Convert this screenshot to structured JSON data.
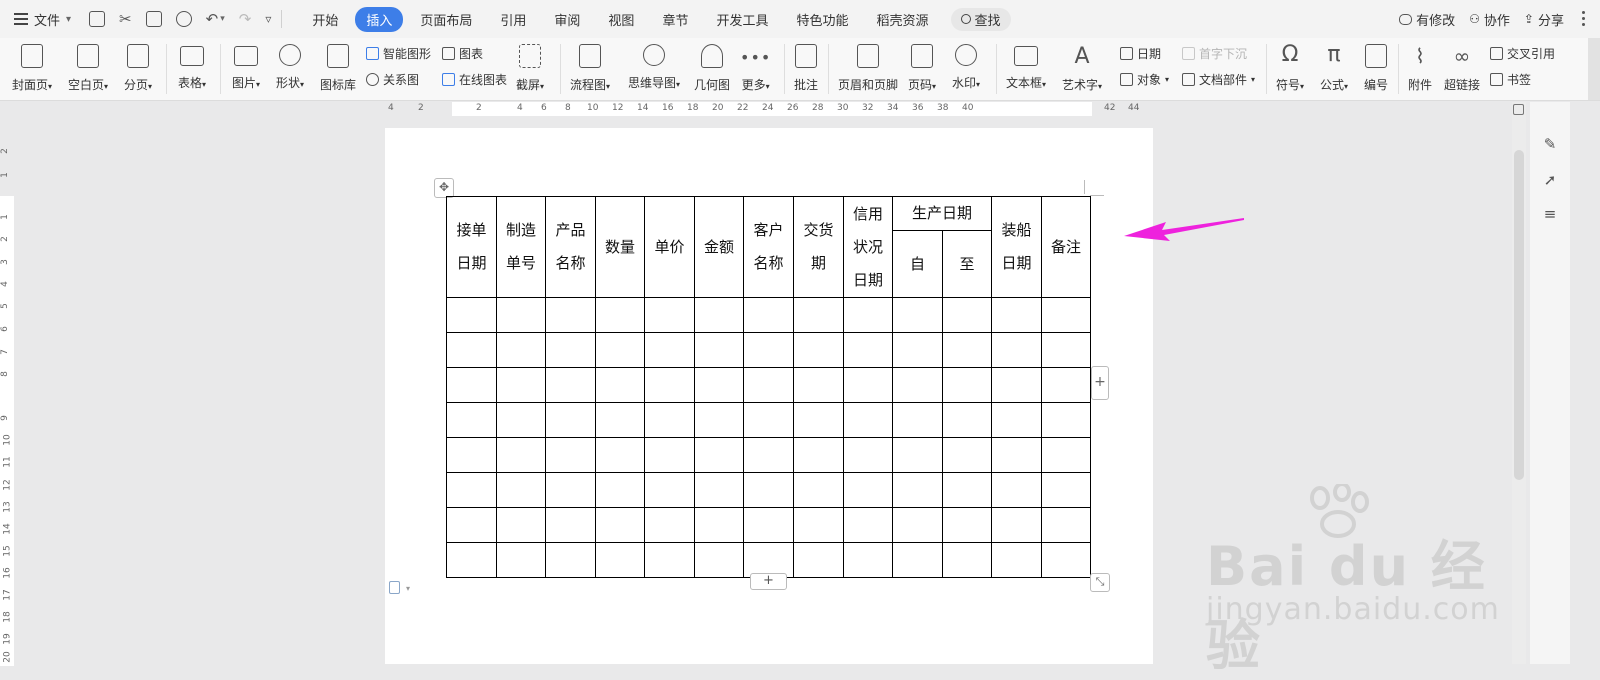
{
  "menu": {
    "file_label": "文件",
    "undo_caret": "▾",
    "tabs": [
      {
        "label": "开始",
        "active": false
      },
      {
        "label": "插入",
        "active": true
      },
      {
        "label": "页面布局",
        "active": false
      },
      {
        "label": "引用",
        "active": false
      },
      {
        "label": "审阅",
        "active": false
      },
      {
        "label": "视图",
        "active": false
      },
      {
        "label": "章节",
        "active": false
      },
      {
        "label": "开发工具",
        "active": false
      },
      {
        "label": "特色功能",
        "active": false
      },
      {
        "label": "稻壳资源",
        "active": false
      }
    ],
    "search_label": "查找",
    "right": {
      "modified": "有修改",
      "collab": "协作",
      "share": "分享"
    }
  },
  "ribbon": {
    "cover": "封面页",
    "blank": "空白页",
    "pagebreak": "分页",
    "table": "表格",
    "picture": "图片",
    "shape": "形状",
    "icon_lib": "图标库",
    "smart_graphic": "智能图形",
    "chart": "图表",
    "relation": "关系图",
    "online_chart": "在线图表",
    "screenshot": "截屏",
    "flowchart": "流程图",
    "mindmap": "思维导图",
    "geometry": "几何图",
    "more": "更多",
    "comment": "批注",
    "header_footer": "页眉和页脚",
    "page_number": "页码",
    "watermark": "水印",
    "textbox": "文本框",
    "wordart": "艺术字",
    "date": "日期",
    "object": "对象",
    "dropcap": "首字下沉",
    "doc_parts": "文档部件",
    "symbol": "符号",
    "formula": "公式",
    "numbering": "编号",
    "attachment": "附件",
    "hyperlink": "超链接",
    "cross_ref": "交叉引用",
    "bookmark": "书签",
    "caret": "▾"
  },
  "ruler": {
    "h_ticks": [
      "4",
      "2",
      "2",
      "4",
      "6",
      "8",
      "10",
      "12",
      "14",
      "16",
      "18",
      "20",
      "22",
      "24",
      "26",
      "28",
      "30",
      "32",
      "34",
      "36",
      "38",
      "40",
      "42",
      "44"
    ],
    "v_ticks": [
      "2",
      "1",
      "1",
      "2",
      "3",
      "4",
      "5",
      "6",
      "7",
      "8",
      "9",
      "10",
      "11",
      "12",
      "13",
      "14",
      "15",
      "16",
      "17",
      "18",
      "19",
      "20"
    ]
  },
  "table": {
    "headers": {
      "order_date": [
        "接单",
        "日期"
      ],
      "mfg_no": [
        "制造",
        "单号"
      ],
      "product_name": [
        "产品",
        "名称"
      ],
      "quantity": "数量",
      "unit_price": "单价",
      "amount": "金额",
      "customer_name": [
        "客户",
        "名称"
      ],
      "delivery": [
        "交货",
        "期"
      ],
      "credit": [
        "信用",
        "状况",
        "日期"
      ],
      "production_date": "生产日期",
      "from": "自",
      "to": "至",
      "ship_date": [
        "装船",
        "日期"
      ],
      "remarks": "备注"
    },
    "empty_rows": 8,
    "columns": 13
  },
  "controls": {
    "add": "+",
    "move": "✥",
    "resize": "⤡"
  },
  "watermark": {
    "brand": "Bai du 经验",
    "url": "jingyan.baidu.com"
  },
  "colors": {
    "accent": "#3d7ee8",
    "arrow": "#ee22dd",
    "watermark": "#d2d2d2"
  }
}
